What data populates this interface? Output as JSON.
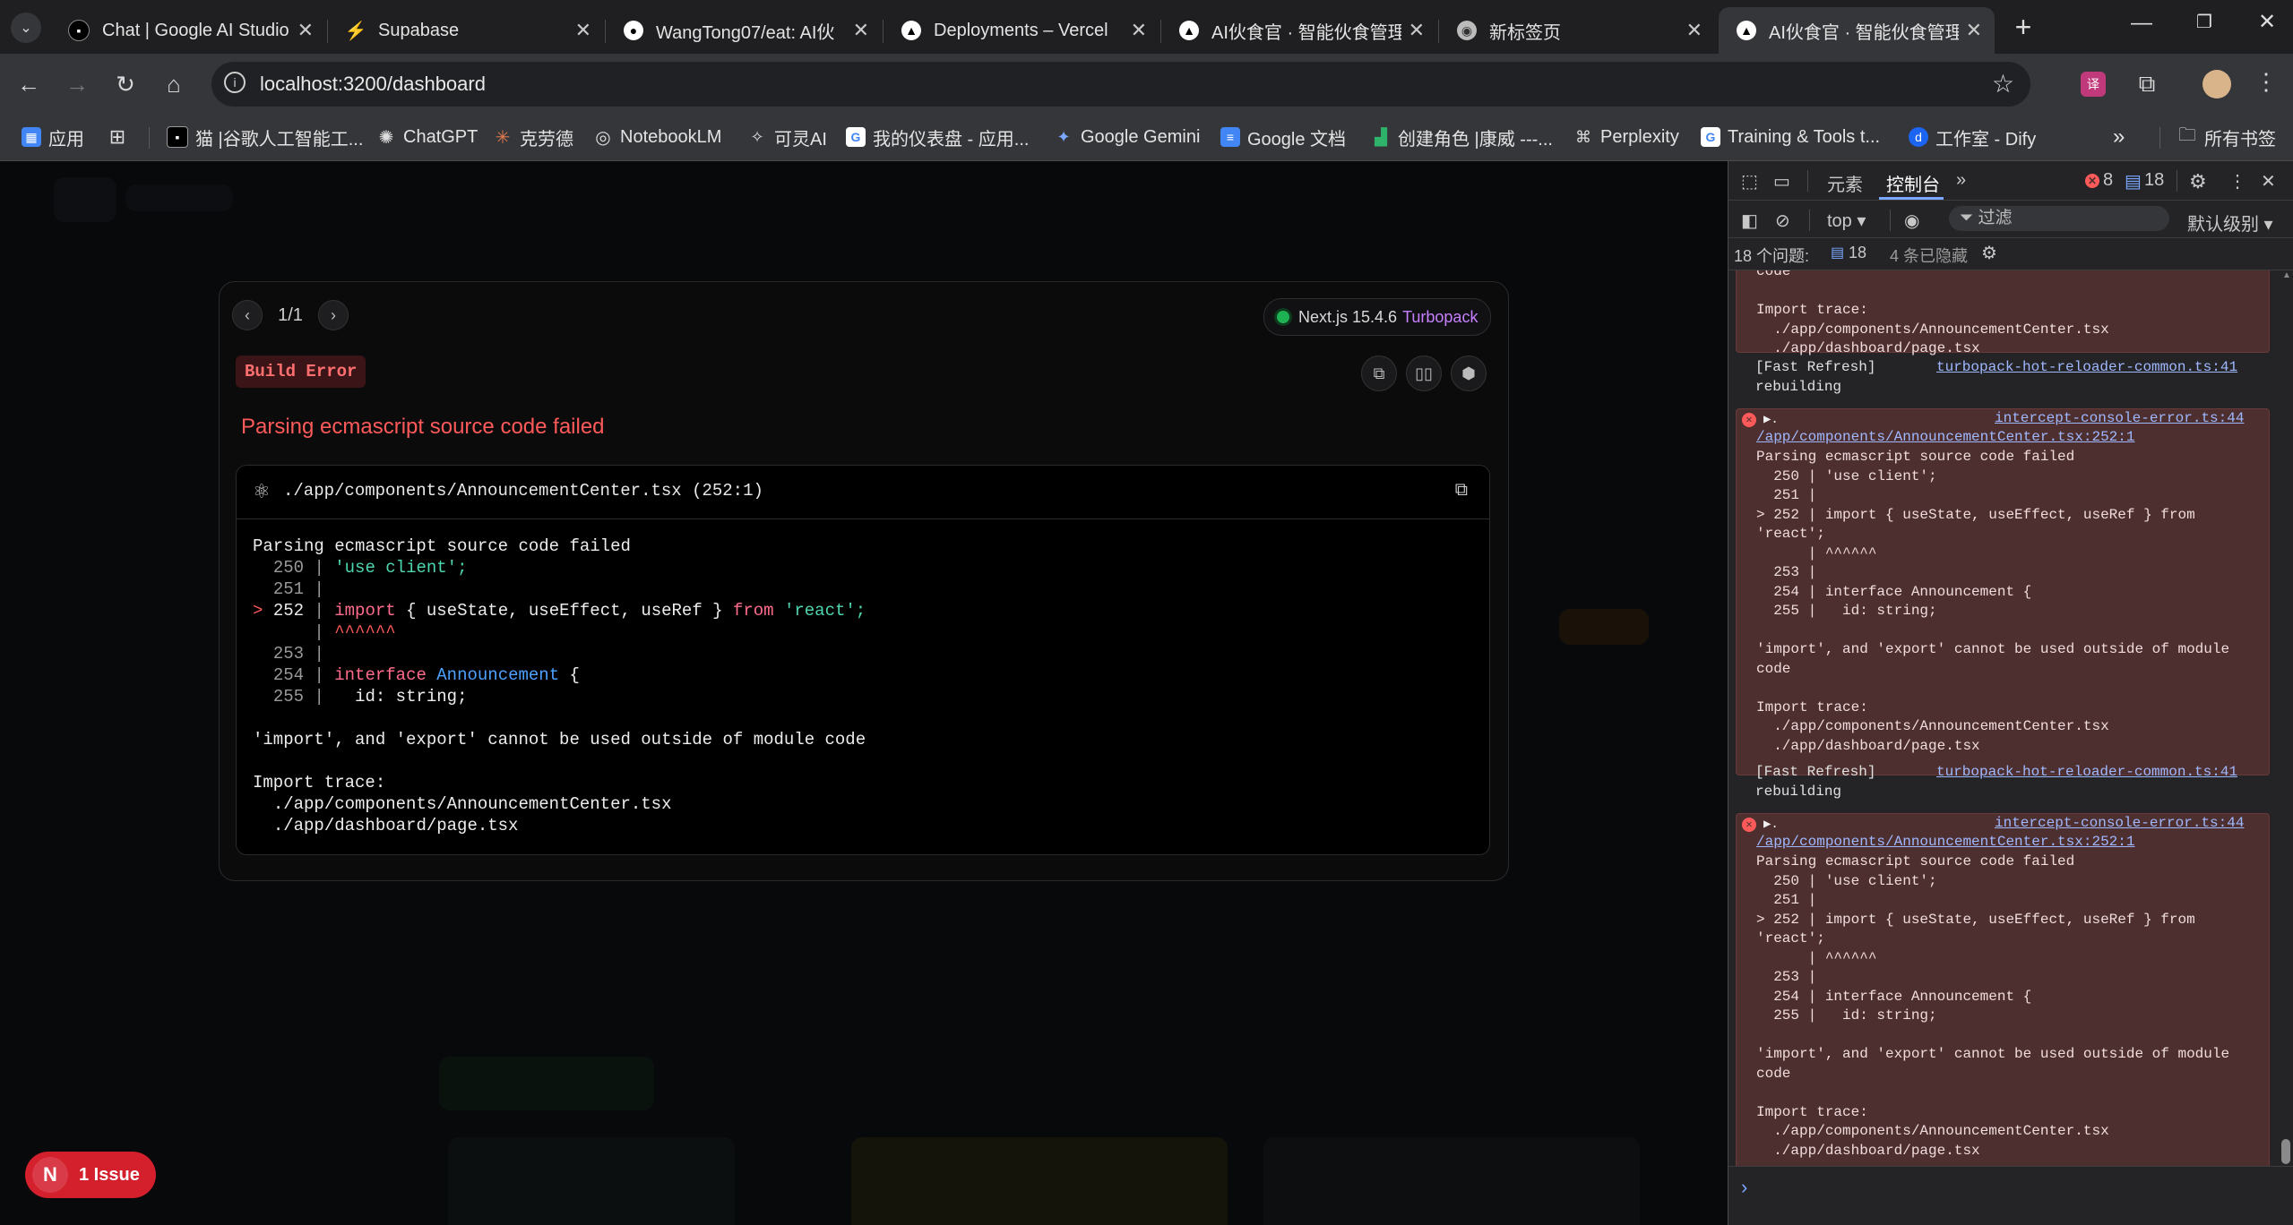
{
  "tabs": [
    {
      "title": "Chat | Google AI Studio",
      "icon": "ai-studio-icon"
    },
    {
      "title": "Supabase",
      "icon": "supabase-icon"
    },
    {
      "title": "WangTong07/eat: AI伙",
      "icon": "github-icon"
    },
    {
      "title": "Deployments – Vercel",
      "icon": "vercel-icon"
    },
    {
      "title": "AI伙食官 · 智能伙食管理",
      "icon": "vercel-icon"
    },
    {
      "title": "新标签页",
      "icon": "chrome-icon"
    },
    {
      "title": "AI伙食官 · 智能伙食管理",
      "icon": "vercel-icon"
    }
  ],
  "toolbar": {
    "url": "localhost:3200/dashboard"
  },
  "bookmarks": [
    {
      "label": "应用"
    },
    {
      "label": ""
    },
    {
      "label": "猫 |谷歌人工智能工..."
    },
    {
      "label": "ChatGPT"
    },
    {
      "label": "克劳德"
    },
    {
      "label": "NotebookLM"
    },
    {
      "label": "可灵AI"
    },
    {
      "label": "我的仪表盘 - 应用..."
    },
    {
      "label": "Google Gemini"
    },
    {
      "label": "Google 文档"
    },
    {
      "label": "创建角色 |康威 ---..."
    },
    {
      "label": "Perplexity"
    },
    {
      "label": "Training & Tools t..."
    },
    {
      "label": "工作室 - Dify"
    },
    {
      "label": "所有书签"
    }
  ],
  "overlay": {
    "pager": "1/1",
    "version": "Next.js 15.4.6",
    "bundler": "Turbopack",
    "badge": "Build Error",
    "title": "Parsing ecmascript source code failed",
    "file": "./app/components/AnnouncementCenter.tsx (252:1)",
    "message_line": "Parsing ecmascript source code failed",
    "error_text": "'import', and 'export' cannot be used outside of module code",
    "trace_title": "Import trace:",
    "trace": [
      "./app/components/AnnouncementCenter.tsx",
      "./app/dashboard/page.tsx"
    ],
    "code": {
      "l250": "250",
      "l251": "251",
      "l252": "252",
      "l253": "253",
      "l254": "254",
      "l255": "255",
      "use_client": "'use client';",
      "import_kw": "import",
      "import_names": "{ useState, useEffect, useRef }",
      "from_kw": "from",
      "react_str": "'react';",
      "carets": "^^^^^^",
      "interface_kw": "interface",
      "interface_name": "Announcement",
      "brace": "{",
      "id_line": "id: string;"
    }
  },
  "issue_button": {
    "letter": "N",
    "label": "1 Issue"
  },
  "devtools": {
    "tab_elements": "元素",
    "tab_console": "控制台",
    "error_count": "8",
    "message_count": "18",
    "context": "top",
    "filter_placeholder": "过滤",
    "level": "默认级别",
    "issues_label": "18 个问题:",
    "issues_count": "18",
    "hidden_label": "4 条已隐藏",
    "entries": {
      "top_partial": "code\n\nImport trace:\n  ./app/components/AnnouncementCenter.tsx\n  ./app/dashboard/page.tsx",
      "refresh_text": "[Fast Refresh]\nrebuilding",
      "refresh_link": "turbopack-hot-reloader-common.ts:41",
      "err_link": "intercept-console-error.ts:44",
      "err_path": "/app/components/AnnouncementCenter.tsx:252:1",
      "err_body": "Parsing ecmascript source code failed\n  250 | 'use client';\n  251 |\n> 252 | import { useState, useEffect, useRef } from\n'react';\n      | ^^^^^^\n  253 |\n  254 | interface Announcement {\n  255 |   id: string;\n\n'import', and 'export' cannot be used outside of module\ncode\n\nImport trace:\n  ./app/components/AnnouncementCenter.tsx\n  ./app/dashboard/page.tsx"
    }
  }
}
